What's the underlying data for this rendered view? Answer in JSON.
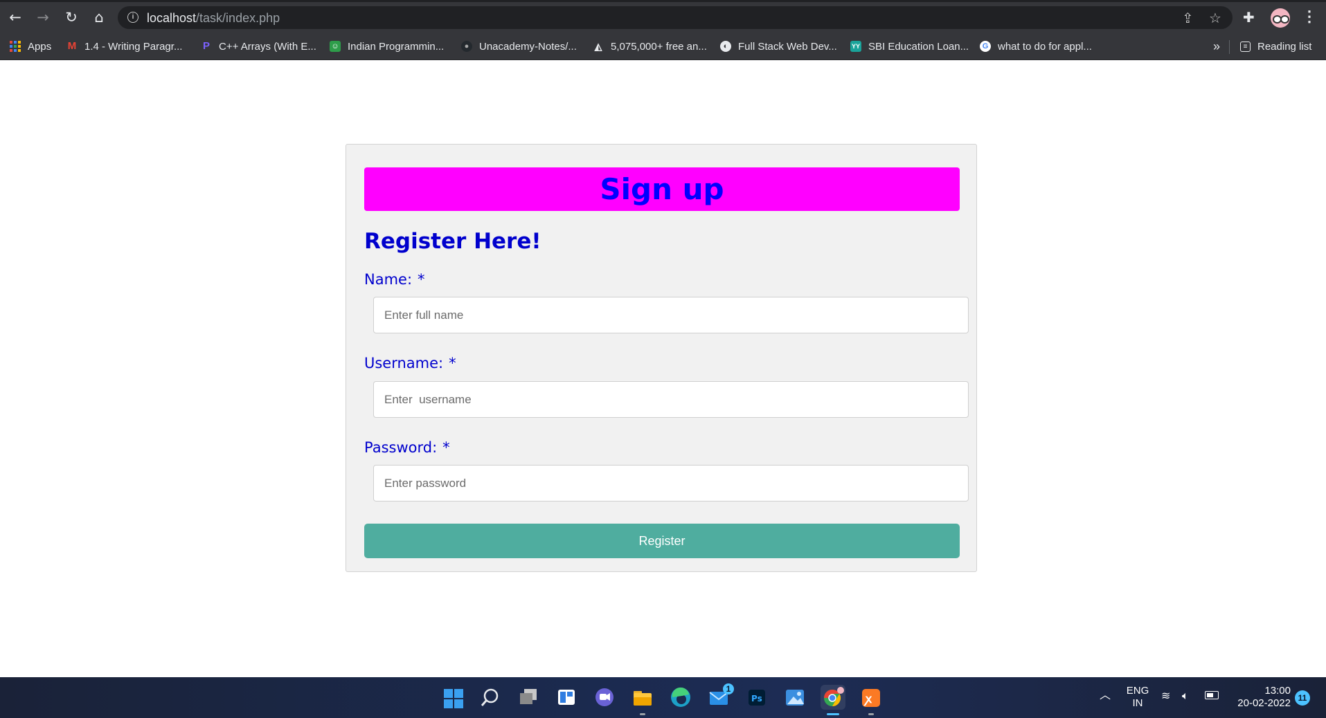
{
  "browser": {
    "url_host": "localhost",
    "url_path": "/task/index.php",
    "bookmarks": [
      {
        "label": "Apps"
      },
      {
        "label": "1.4 - Writing Paragr..."
      },
      {
        "label": "C++ Arrays (With E..."
      },
      {
        "label": "Indian Programmin..."
      },
      {
        "label": "Unacademy-Notes/..."
      },
      {
        "label": "5,075,000+ free an..."
      },
      {
        "label": "Full Stack Web Dev..."
      },
      {
        "label": "SBI Education Loan..."
      },
      {
        "label": "what to do for appl..."
      }
    ],
    "overflow_label": "»",
    "reading_list_label": "Reading list"
  },
  "form": {
    "banner_title": "Sign up",
    "heading": "Register Here!",
    "name_label": "Name:",
    "name_placeholder": "Enter full name",
    "username_label": "Username:",
    "username_placeholder": "Enter  username",
    "password_label": "Password:",
    "password_placeholder": "Enter password",
    "required_marker": "*",
    "submit_label": "Register"
  },
  "taskbar": {
    "mail_badge": "1",
    "lang_line1": "ENG",
    "lang_line2": "IN",
    "time": "13:00",
    "date": "20-02-2022",
    "notification_count": "11"
  },
  "colors": {
    "banner_bg": "#ff00ff",
    "banner_text": "#0000ff",
    "label_text": "#0000cd",
    "button_bg": "#4fad9f"
  }
}
